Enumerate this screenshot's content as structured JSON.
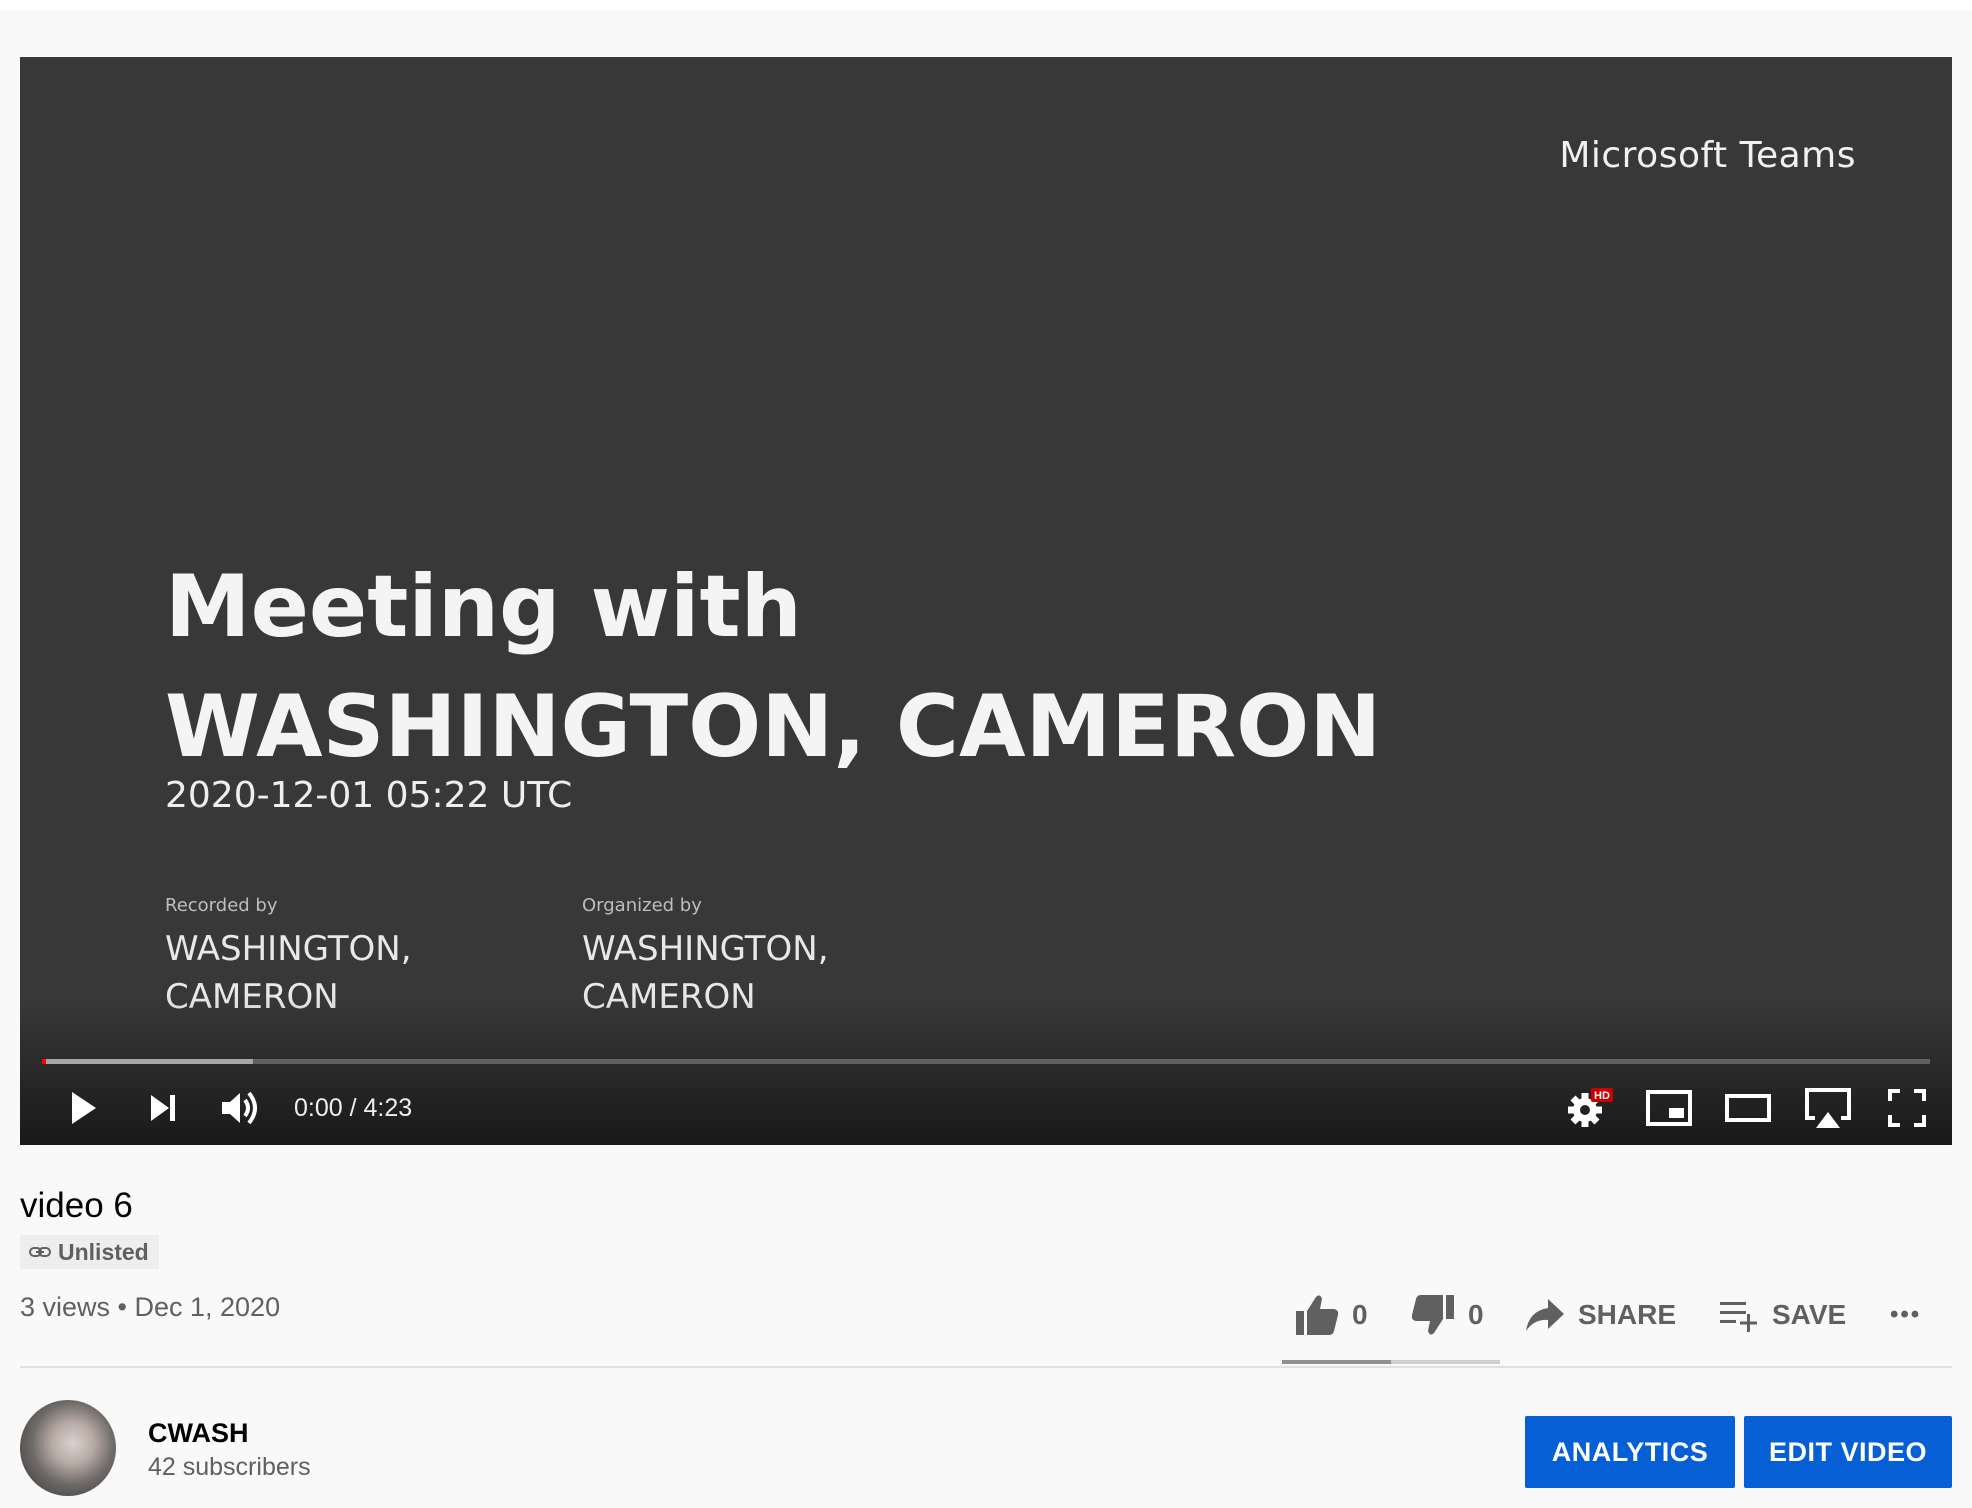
{
  "player": {
    "frame": {
      "brand": "Microsoft Teams",
      "title": "Meeting with WASHINGTON, CAMERON",
      "date": "2020-12-01 05:22 UTC",
      "recorded_by_label": "Recorded by",
      "recorded_by": "WASHINGTON, CAMERON",
      "organized_by_label": "Organized by",
      "organized_by": "WASHINGTON, CAMERON"
    },
    "progress": {
      "played_fraction": 0.0,
      "buffered_fraction": 0.112
    },
    "time": "0:00 / 4:23",
    "controls": [
      "play-icon",
      "next-icon",
      "volume-icon",
      "settings-icon",
      "miniplayer-icon",
      "theater-icon",
      "airplay-icon",
      "fullscreen-icon"
    ],
    "quality_badge": "HD",
    "badge_color": "#cc0000"
  },
  "video": {
    "title": "video 6",
    "visibility": "Unlisted",
    "views_date": "3 views • Dec 1, 2020"
  },
  "actions": {
    "likes": "0",
    "dislikes": "0",
    "share": "SHARE",
    "save": "SAVE",
    "more": "•••"
  },
  "channel": {
    "name": "CWASH",
    "subscribers": "42 subscribers"
  },
  "buttons": {
    "analytics": "ANALYTICS",
    "edit": "EDIT VIDEO",
    "color": "#065fd4"
  }
}
